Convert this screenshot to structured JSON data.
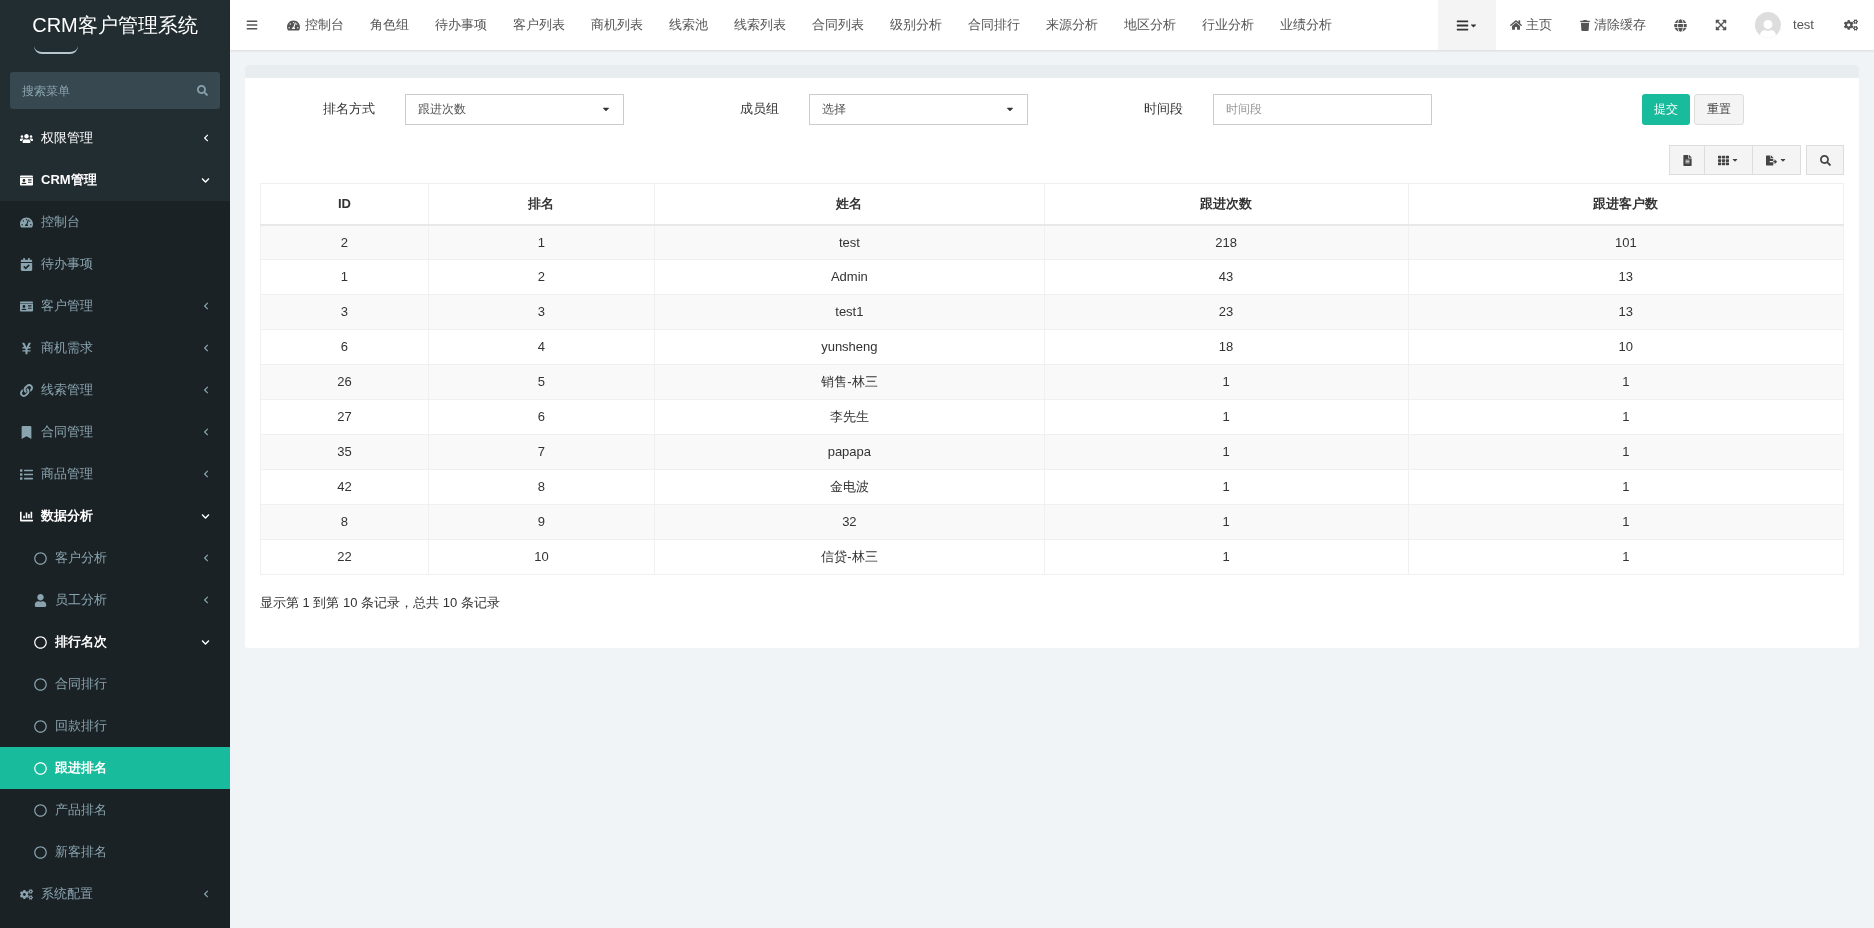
{
  "sidebar": {
    "title": "CRM客户管理系统",
    "search": {
      "placeholder": "搜索菜单"
    },
    "items": [
      {
        "label": "权限管理",
        "kind": "folder",
        "expanded": false,
        "selected": false
      },
      {
        "label": "CRM管理",
        "kind": "folder",
        "expanded": true,
        "selected": false,
        "children": [
          {
            "label": "控制台",
            "kind": "link",
            "selected": false
          },
          {
            "label": "待办事项",
            "kind": "link",
            "selected": false
          },
          {
            "label": "客户管理",
            "kind": "folder",
            "expanded": false,
            "selected": false
          },
          {
            "label": "商机需求",
            "kind": "folder",
            "expanded": false,
            "selected": false
          },
          {
            "label": "线索管理",
            "kind": "folder",
            "expanded": false,
            "selected": false
          },
          {
            "label": "合同管理",
            "kind": "folder",
            "expanded": false,
            "selected": false
          },
          {
            "label": "商品管理",
            "kind": "folder",
            "expanded": false,
            "selected": false
          },
          {
            "label": "数据分析",
            "kind": "folder",
            "expanded": true,
            "selected": false,
            "children": [
              {
                "label": "客户分析",
                "kind": "folder",
                "expanded": false,
                "selected": false
              },
              {
                "label": "员工分析",
                "kind": "folder",
                "expanded": false,
                "selected": false
              },
              {
                "label": "排行名次",
                "kind": "folder",
                "expanded": true,
                "selected": false,
                "children": [
                  {
                    "label": "合同排行",
                    "kind": "link",
                    "selected": false
                  },
                  {
                    "label": "回款排行",
                    "kind": "link",
                    "selected": false
                  },
                  {
                    "label": "跟进排名",
                    "kind": "link",
                    "selected": true
                  },
                  {
                    "label": "产品排名",
                    "kind": "link",
                    "selected": false
                  },
                  {
                    "label": "新客排名",
                    "kind": "link",
                    "selected": false
                  }
                ]
              }
            ]
          },
          {
            "label": "系统配置",
            "kind": "folder",
            "expanded": false,
            "selected": false
          }
        ]
      }
    ]
  },
  "top_tabs": [
    {
      "label": "控制台"
    },
    {
      "label": "角色组"
    },
    {
      "label": "待办事项"
    },
    {
      "label": "客户列表"
    },
    {
      "label": "商机列表"
    },
    {
      "label": "线索池"
    },
    {
      "label": "线索列表"
    },
    {
      "label": "合同列表"
    },
    {
      "label": "级别分析"
    },
    {
      "label": "合同排行"
    },
    {
      "label": "来源分析"
    },
    {
      "label": "地区分析"
    },
    {
      "label": "行业分析"
    },
    {
      "label": "业绩分析"
    }
  ],
  "top_right": {
    "home": "主页",
    "clear_cache": "清除缓存",
    "user": "test"
  },
  "filters": [
    {
      "label": "排名方式",
      "kind": "select",
      "value": "跟进次数"
    },
    {
      "label": "成员组",
      "kind": "select",
      "value": "选择"
    },
    {
      "label": "时间段",
      "kind": "input",
      "placeholder": "时间段"
    }
  ],
  "buttons": {
    "submit": "提交",
    "reset": "重置"
  },
  "table": {
    "columns": [
      "ID",
      "排名",
      "姓名",
      "跟进次数",
      "跟进客户数"
    ],
    "rows": [
      [
        "2",
        "1",
        "test",
        "218",
        "101"
      ],
      [
        "1",
        "2",
        "Admin",
        "43",
        "13"
      ],
      [
        "3",
        "3",
        "test1",
        "23",
        "13"
      ],
      [
        "6",
        "4",
        "yunsheng",
        "18",
        "10"
      ],
      [
        "26",
        "5",
        "销售-林三",
        "1",
        "1"
      ],
      [
        "27",
        "6",
        "李先生",
        "1",
        "1"
      ],
      [
        "35",
        "7",
        "papapa",
        "1",
        "1"
      ],
      [
        "42",
        "8",
        "金电波",
        "1",
        "1"
      ],
      [
        "8",
        "9",
        "32",
        "1",
        "1"
      ],
      [
        "22",
        "10",
        "信贷-林三",
        "1",
        "1"
      ]
    ]
  },
  "pagination_info": "显示第 1 到第 10 条记录，总共 10 条记录"
}
